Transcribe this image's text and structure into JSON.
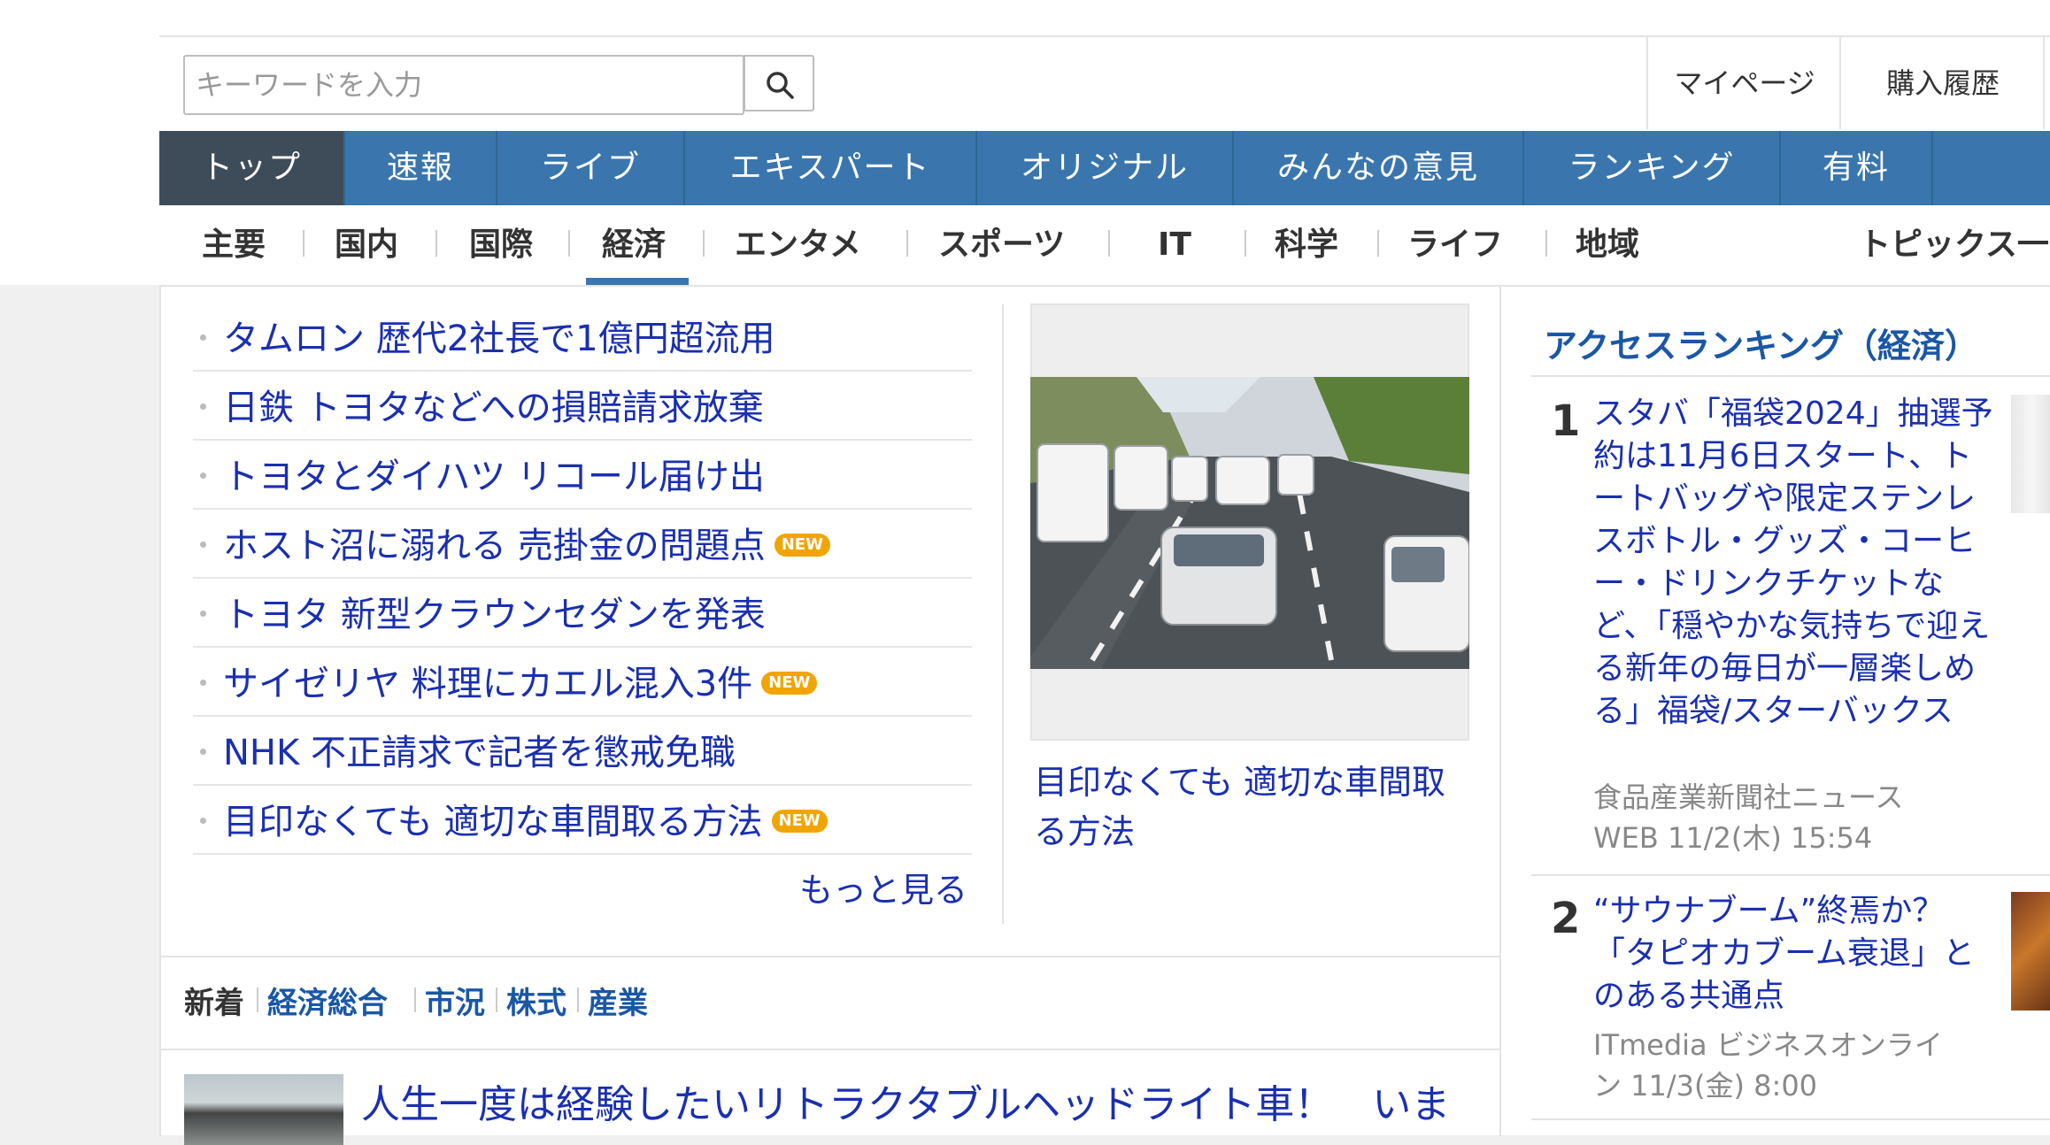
{
  "header": {
    "search": {
      "placeholder": "キーワードを入力"
    },
    "util_links": [
      "マイページ",
      "購入履歴"
    ]
  },
  "global_nav": [
    "トップ",
    "速報",
    "ライブ",
    "エキスパート",
    "オリジナル",
    "みんなの意見",
    "ランキング",
    "有料"
  ],
  "global_nav_active": "トップ",
  "category_nav": [
    "主要",
    "国内",
    "国際",
    "経済",
    "エンタメ",
    "スポーツ",
    "IT",
    "科学",
    "ライフ",
    "地域",
    "トピックス一"
  ],
  "category_nav_active": "経済",
  "main": {
    "news": [
      {
        "title": "タムロン 歴代2社長で1億円超流用",
        "new": false
      },
      {
        "title": "日鉄 トヨタなどへの損賠請求放棄",
        "new": false
      },
      {
        "title": "トヨタとダイハツ リコール届け出",
        "new": false
      },
      {
        "title": "ホスト沼に溺れる 売掛金の問題点",
        "new": true
      },
      {
        "title": "トヨタ 新型クラウンセダンを発表",
        "new": false
      },
      {
        "title": "サイゼリヤ 料理にカエル混入3件",
        "new": true
      },
      {
        "title": "NHK 不正請求で記者を懲戒免職",
        "new": false
      },
      {
        "title": "目印なくても 適切な車間取る方法",
        "new": true
      }
    ],
    "new_badge": "NEW",
    "more": "もっと見る",
    "photo_caption": "目印なくても 適切な車間取る方法",
    "subtabs": [
      "新着",
      "経済総合",
      "市況",
      "株式",
      "産業"
    ],
    "bottom_article": "人生一度は経験したいリトラクタブルヘッドライト車！　いま"
  },
  "ranking": {
    "title": "アクセスランキング（経済）",
    "items": [
      {
        "rank": "1",
        "headline": "スタバ「福袋2024」抽選予約は11月6日スタート、トートバッグや限定ステンレスボトル・グッズ・コーヒー・ドリンクチケットなど、「穏やかな気持ちで迎える新年の毎日が一層楽しめる」福袋/スターバックス",
        "source": "食品産業新聞社ニュースWEB 11/2(木) 15:54"
      },
      {
        "rank": "2",
        "headline": "“サウナブーム”終焉か？「タピオカブーム衰退」とのある共通点",
        "source": "ITmedia ビジネスオンライン 11/3(金) 8:00"
      }
    ]
  },
  "colors": {
    "nav_bg": "#3a76ad",
    "nav_active": "#3e4c5a",
    "link": "#1a2fb0",
    "ranking_title": "#1a57a6",
    "new_badge": "#f0a500"
  },
  "icons": [
    "search-icon"
  ]
}
